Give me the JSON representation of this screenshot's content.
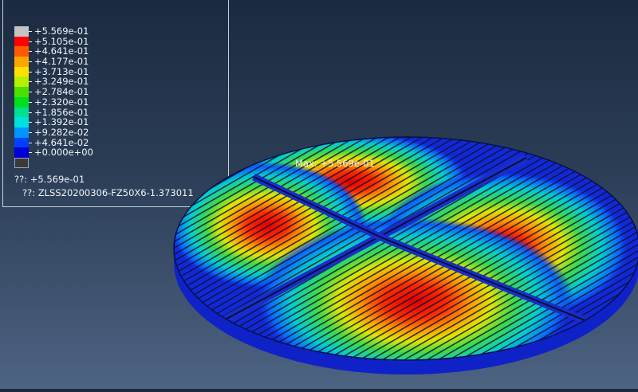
{
  "legend": {
    "entries": [
      {
        "value": "+5.569e-01",
        "color": "#c4c4c4"
      },
      {
        "value": "+5.105e-01",
        "color": "#ff0000"
      },
      {
        "value": "+4.641e-01",
        "color": "#ff5a00"
      },
      {
        "value": "+4.177e-01",
        "color": "#ffa500"
      },
      {
        "value": "+3.713e-01",
        "color": "#ffe000"
      },
      {
        "value": "+3.249e-01",
        "color": "#b4f000"
      },
      {
        "value": "+2.784e-01",
        "color": "#4ce000"
      },
      {
        "value": "+2.320e-01",
        "color": "#00e01c"
      },
      {
        "value": "+1.856e-01",
        "color": "#00e090"
      },
      {
        "value": "+1.392e-01",
        "color": "#00e0e0"
      },
      {
        "value": "+9.282e-02",
        "color": "#0096ff"
      },
      {
        "value": "+4.641e-02",
        "color": "#0040ff"
      },
      {
        "value": "+0.000e+00",
        "color": "#0000d8"
      }
    ],
    "below_range_color": "#3a3a3a",
    "max_line": "??: +5.569e-01",
    "file_line": "??: ZLSS20200306-FZ50X6-1.373011"
  },
  "viewport": {
    "max_annotation": "Max: +5.569e-01"
  }
}
